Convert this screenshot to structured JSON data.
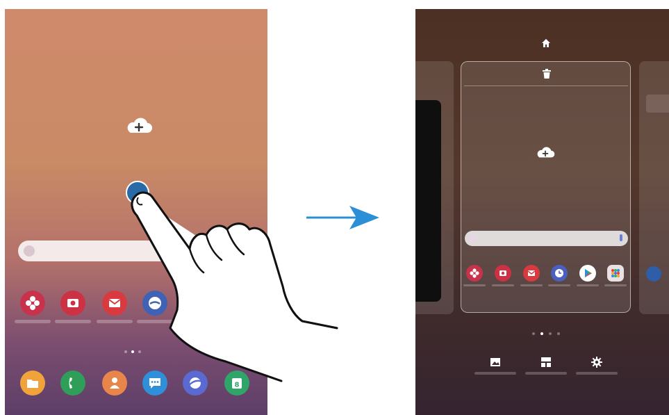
{
  "colors": {
    "accent_blue": "#2a8fd6",
    "tap_dot": "#2a6aa6",
    "left_bg_top": "#cf8a6b",
    "left_bg_bottom": "#5d3e68",
    "right_bg_top": "#4b3023",
    "right_bg_bottom": "#352430"
  },
  "left_screen": {
    "icons": [
      "add-cloud-icon",
      "tap-indicator",
      "google-search-bar"
    ],
    "apps_row": [
      "gallery-icon",
      "camera-icon",
      "email-icon",
      "samsung-notes-icon",
      "app-icon"
    ],
    "dock": [
      "my-files-icon",
      "phone-icon",
      "contacts-icon",
      "messages-icon",
      "internet-icon",
      "calendar-icon"
    ],
    "calendar_day": "8"
  },
  "transition": {
    "icon": "arrow-right-icon"
  },
  "right_screen": {
    "icons": [
      "home-icon",
      "trash-icon",
      "add-cloud-icon"
    ],
    "card_apps": [
      "gallery-icon",
      "camera-icon",
      "email-icon",
      "clock-icon",
      "play-store-icon",
      "app-folder-icon"
    ],
    "bottom_options": [
      "wallpapers-icon",
      "widgets-icon",
      "home-screen-settings-icon"
    ]
  }
}
